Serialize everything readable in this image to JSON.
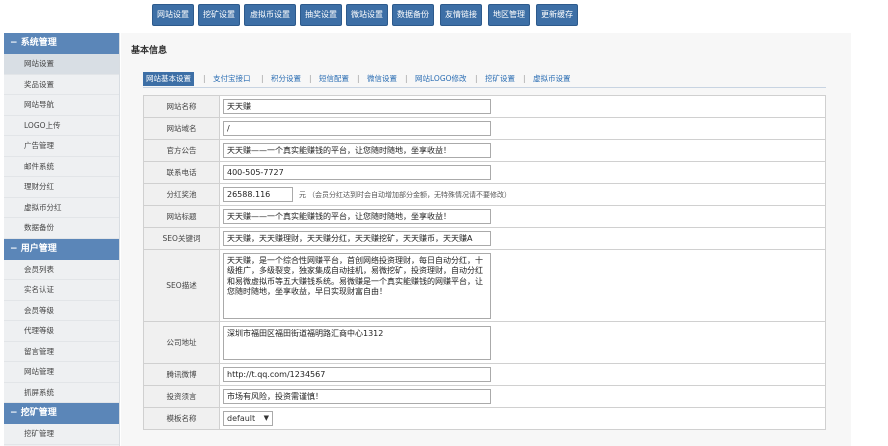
{
  "topnav": {
    "buttons": [
      "网站设置",
      "挖矿设置",
      "虚拟币设置",
      "抽奖设置",
      "微站设置",
      "数据备份",
      "友情链接",
      "地区管理",
      "更新缓存"
    ]
  },
  "sidebar": {
    "sections": [
      {
        "title": "系统管理",
        "items": [
          "网站设置",
          "奖品设置",
          "网站导航",
          "LOGO上传",
          "广告管理",
          "邮件系统",
          "理财分红",
          "虚拟币分红",
          "数据备份"
        ]
      },
      {
        "title": "用户管理",
        "items": [
          "会员列表",
          "实名认证",
          "会员等级",
          "代理等级",
          "留言管理",
          "网站管理",
          "抓屏系统"
        ]
      },
      {
        "title": "挖矿管理",
        "items": [
          "挖矿管理"
        ]
      }
    ],
    "active_item": "网站设置"
  },
  "main": {
    "title": "基本信息",
    "tabs": [
      "网站基本设置",
      "支付宝接口",
      "积分设置",
      "短信配置",
      "微信设置",
      "网站LOGO修改",
      "挖矿设置",
      "虚拟币设置"
    ],
    "active_tab": "网站基本设置",
    "tab_separator": "|"
  },
  "form": {
    "site_name": {
      "label": "网站名称",
      "value": "天天赚"
    },
    "site_domain": {
      "label": "网站域名",
      "value": "/"
    },
    "announcement": {
      "label": "官方公告",
      "value": "天天赚——一个真实能赚钱的平台，让您随时随地，坐享收益！"
    },
    "phone": {
      "label": "联系电话",
      "value": "400-505-7727"
    },
    "dividend": {
      "label": "分红奖池",
      "value": "26588.116",
      "unit": "元",
      "note": "（会员分红达到时会自动增加部分金额，无特殊情况请不要修改）"
    },
    "site_title": {
      "label": "网站标题",
      "value": "天天赚——一个真实能赚钱的平台，让您随时随地，坐享收益！"
    },
    "seo_keywords": {
      "label": "SEO关键词",
      "value": "天天赚，天天赚理财，天天赚分红，天天赚挖矿，天天赚币，天天赚A"
    },
    "seo_description": {
      "label": "SEO描述",
      "value": "天天赚，是一个综合性网赚平台，首创网络投资理财，每日自动分红，十级推广，多级裂变，独家集成自动挂机，易微挖矿，投资理财，自动分红和易微虚拟币等五大赚钱系统。易微赚是一个真实能赚钱的网赚平台，让您随时随地，坐享收益，早日实现财富自由！"
    },
    "company_address": {
      "label": "公司地址",
      "value": "深圳市福田区福田街道福明路汇商中心1312"
    },
    "weibo": {
      "label": "腾讯微博",
      "value": "http://t.qq.com/1234567"
    },
    "invest_note": {
      "label": "投资须言",
      "value": "市场有风险，投资需谨慎！"
    },
    "template": {
      "label": "模板名称",
      "value": "default"
    }
  }
}
